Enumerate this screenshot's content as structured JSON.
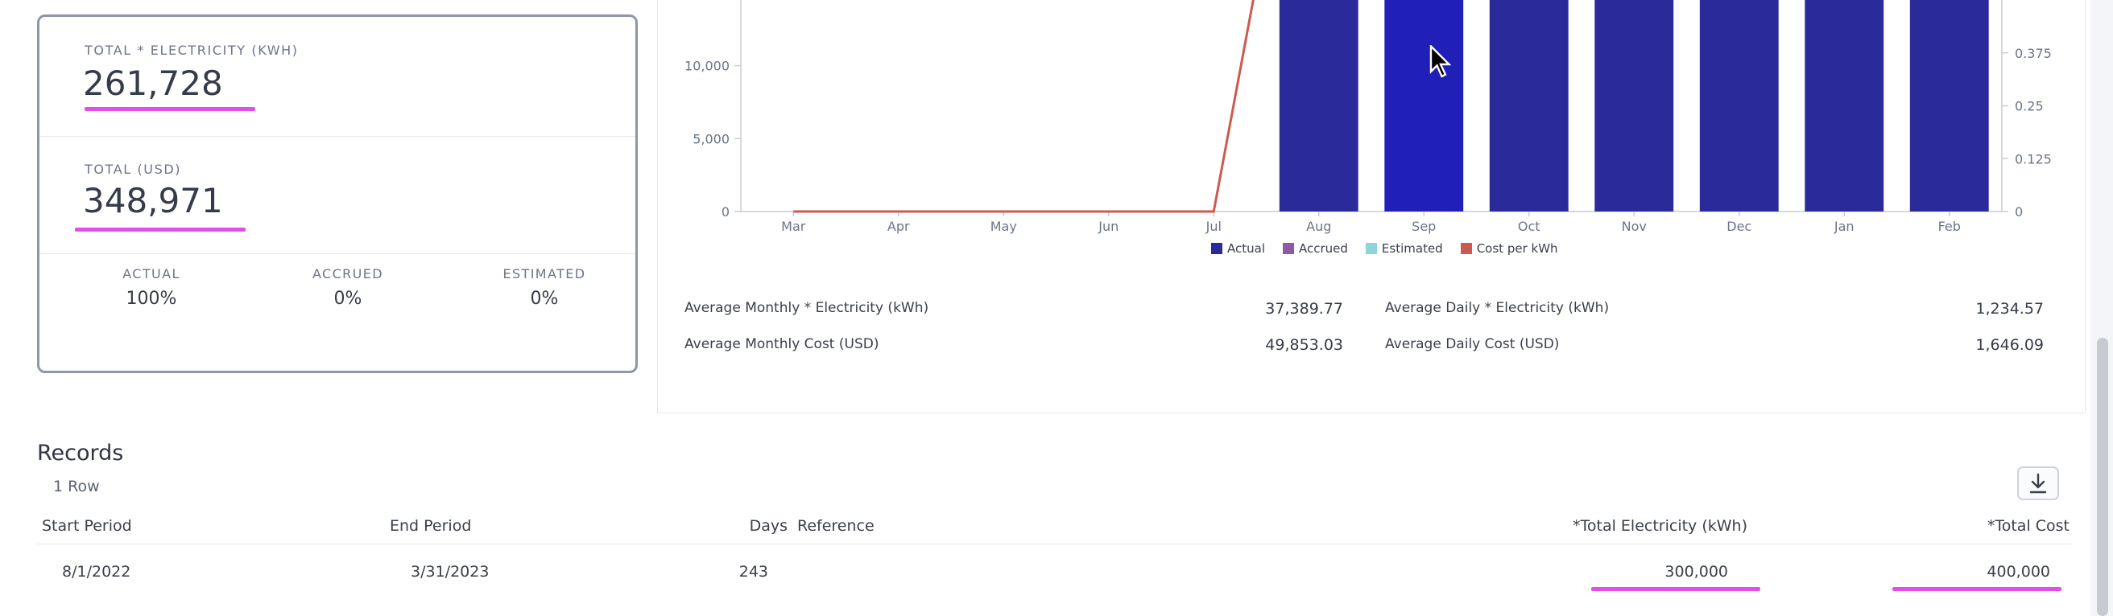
{
  "summary": {
    "total_electricity_label": "TOTAL * ELECTRICITY (KWH)",
    "total_electricity_value": "261,728",
    "total_usd_label": "TOTAL (USD)",
    "total_usd_value": "348,971",
    "actual_label": "ACTUAL",
    "actual_value": "100%",
    "accrued_label": "ACCRUED",
    "accrued_value": "0%",
    "estimated_label": "ESTIMATED",
    "estimated_value": "0%"
  },
  "chart_data": {
    "type": "bar",
    "categories": [
      "Mar",
      "Apr",
      "May",
      "Jun",
      "Jul",
      "Aug",
      "Sep",
      "Oct",
      "Nov",
      "Dec",
      "Jan",
      "Feb"
    ],
    "series": [
      {
        "name": "Actual",
        "kind": "bar",
        "axis": "left",
        "color": "#2b2a9a",
        "highlight_color": "#2020b8",
        "values": [
          0,
          0,
          0,
          0,
          0,
          37500,
          37500,
          37500,
          37500,
          37500,
          37500,
          37500
        ]
      },
      {
        "name": "Accrued",
        "kind": "bar",
        "axis": "left",
        "color": "#8e5aa6",
        "values": [
          0,
          0,
          0,
          0,
          0,
          0,
          0,
          0,
          0,
          0,
          0,
          0
        ]
      },
      {
        "name": "Estimated",
        "kind": "bar",
        "axis": "left",
        "color": "#8fd3dc",
        "values": [
          0,
          0,
          0,
          0,
          0,
          0,
          0,
          0,
          0,
          0,
          0,
          0
        ]
      },
      {
        "name": "Cost per kWh",
        "kind": "line",
        "axis": "right",
        "color": "#cc5a4f",
        "values": [
          0,
          0,
          0,
          0,
          0,
          1.33,
          1.33,
          1.33,
          1.33,
          1.33,
          1.33,
          1.33
        ]
      }
    ],
    "y_left": {
      "ticks": [
        "0",
        "5,000",
        "10,000"
      ],
      "tick_values": [
        0,
        5000,
        10000
      ],
      "visible_max": 14500
    },
    "y_right": {
      "ticks": [
        "0",
        "0.125",
        "0.25",
        "0.375"
      ],
      "tick_values": [
        0,
        0.125,
        0.25,
        0.375
      ],
      "visible_max": 0.5
    },
    "highlight_index": 6,
    "legend_placement": "bottom-center",
    "grid": false
  },
  "stats": {
    "avg_monthly_elec_label": "Average Monthly * Electricity (kWh)",
    "avg_monthly_elec_value": "37,389.77",
    "avg_monthly_cost_label": "Average Monthly Cost (USD)",
    "avg_monthly_cost_value": "49,853.03",
    "avg_daily_elec_label": "Average Daily * Electricity (kWh)",
    "avg_daily_elec_value": "1,234.57",
    "avg_daily_cost_label": "Average Daily Cost (USD)",
    "avg_daily_cost_value": "1,646.09"
  },
  "records": {
    "title": "Records",
    "row_count": "1 Row",
    "download_icon": "download-icon",
    "columns": [
      "Start Period",
      "End Period",
      "Days",
      "Reference",
      "*Total Electricity (kWh)",
      "*Total Cost"
    ],
    "rows": [
      {
        "start": "8/1/2022",
        "end": "3/31/2023",
        "days": "243",
        "reference": "",
        "total_elec": "300,000",
        "total_cost": "400,000"
      }
    ]
  },
  "colors": {
    "accent_underline": "#e24fe8",
    "card_border": "#8e96a8"
  }
}
